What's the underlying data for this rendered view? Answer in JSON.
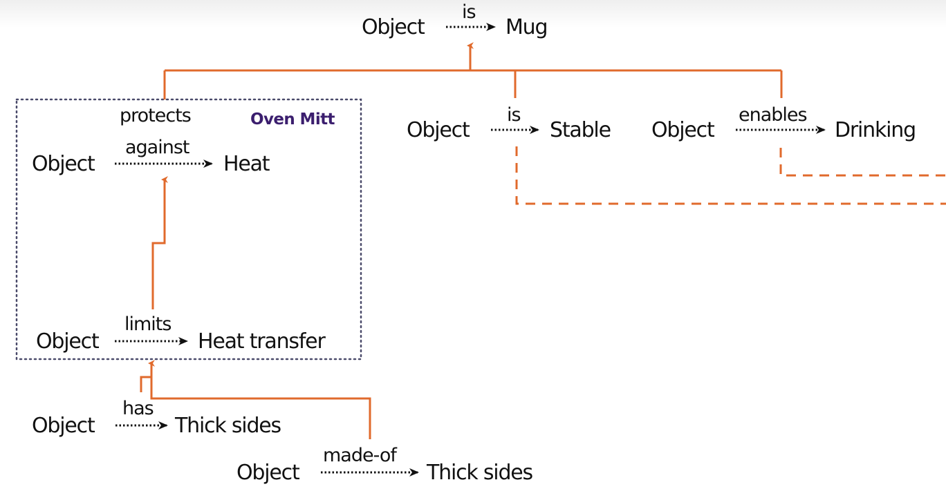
{
  "diagram": {
    "colors": {
      "connector": "#E06A2C",
      "relation_arrow": "#111111",
      "group_border": "#4A4A6A",
      "group_label": "#3B1E6E",
      "text": "#111111"
    },
    "group": {
      "label": "Oven Mitt"
    },
    "triples": [
      {
        "id": "mug",
        "subject": "Object",
        "relation": "is",
        "object": "Mug"
      },
      {
        "id": "stable",
        "subject": "Object",
        "relation": "is",
        "object": "Stable"
      },
      {
        "id": "drinking",
        "subject": "Object",
        "relation": "enables",
        "object": "Drinking"
      },
      {
        "id": "heat",
        "subject": "Object",
        "relation": "protects against",
        "relation_line1": "protects",
        "relation_line2": "against",
        "object": "Heat"
      },
      {
        "id": "transfer",
        "subject": "Object",
        "relation": "limits",
        "object": "Heat transfer"
      },
      {
        "id": "thick",
        "subject": "Object",
        "relation": "has",
        "object": "Thick sides"
      },
      {
        "id": "madeof",
        "subject": "Object",
        "relation": "made-of",
        "object": "Thick sides"
      }
    ],
    "links": [
      {
        "from": "heat",
        "to": "mug",
        "style": "solid"
      },
      {
        "from": "stable",
        "to": "mug",
        "style": "solid"
      },
      {
        "from": "drinking",
        "to": "mug",
        "style": "solid"
      },
      {
        "from": "transfer",
        "to": "heat",
        "style": "solid"
      },
      {
        "from": "thick",
        "to": "transfer",
        "style": "solid"
      },
      {
        "from": "madeof",
        "to": "transfer",
        "style": "solid"
      },
      {
        "from": "stable",
        "to": "offscreen-right",
        "style": "dashed"
      },
      {
        "from": "drinking",
        "to": "offscreen-right",
        "style": "dashed"
      }
    ]
  }
}
